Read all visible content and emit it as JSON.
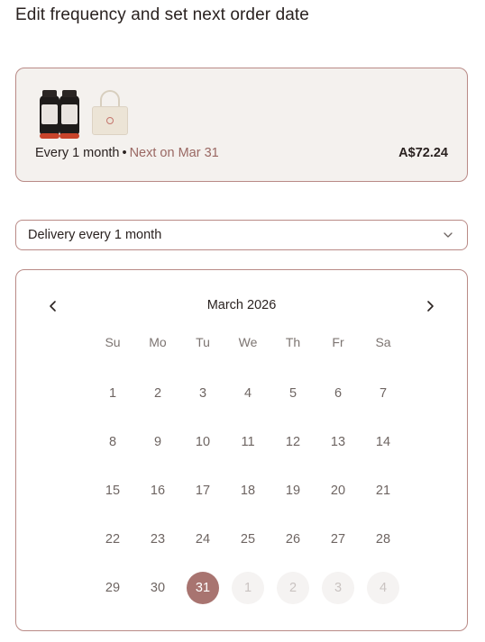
{
  "page": {
    "title": "Edit frequency and set next order date"
  },
  "summary": {
    "frequency_text": "Every 1 month",
    "separator": "•",
    "next_text": "Next on Mar 31",
    "price": "A$72.24",
    "images": [
      "supplement-bottles-image",
      "tote-bag-image"
    ]
  },
  "frequency_select": {
    "value": "Delivery every 1 month",
    "icon": "chevron-down-icon"
  },
  "calendar": {
    "month_label": "March 2026",
    "prev_icon": "chevron-left-icon",
    "next_icon": "chevron-right-icon",
    "weekdays": [
      "Su",
      "Mo",
      "Tu",
      "We",
      "Th",
      "Fr",
      "Sa"
    ],
    "days": [
      {
        "label": "1",
        "state": "normal"
      },
      {
        "label": "2",
        "state": "normal"
      },
      {
        "label": "3",
        "state": "normal"
      },
      {
        "label": "4",
        "state": "normal"
      },
      {
        "label": "5",
        "state": "normal"
      },
      {
        "label": "6",
        "state": "normal"
      },
      {
        "label": "7",
        "state": "normal"
      },
      {
        "label": "8",
        "state": "normal"
      },
      {
        "label": "9",
        "state": "normal"
      },
      {
        "label": "10",
        "state": "normal"
      },
      {
        "label": "11",
        "state": "normal"
      },
      {
        "label": "12",
        "state": "normal"
      },
      {
        "label": "13",
        "state": "normal"
      },
      {
        "label": "14",
        "state": "normal"
      },
      {
        "label": "15",
        "state": "normal"
      },
      {
        "label": "16",
        "state": "normal"
      },
      {
        "label": "17",
        "state": "normal"
      },
      {
        "label": "18",
        "state": "normal"
      },
      {
        "label": "19",
        "state": "normal"
      },
      {
        "label": "20",
        "state": "normal"
      },
      {
        "label": "21",
        "state": "normal"
      },
      {
        "label": "22",
        "state": "normal"
      },
      {
        "label": "23",
        "state": "normal"
      },
      {
        "label": "24",
        "state": "normal"
      },
      {
        "label": "25",
        "state": "normal"
      },
      {
        "label": "26",
        "state": "normal"
      },
      {
        "label": "27",
        "state": "normal"
      },
      {
        "label": "28",
        "state": "normal"
      },
      {
        "label": "29",
        "state": "normal"
      },
      {
        "label": "30",
        "state": "normal"
      },
      {
        "label": "31",
        "state": "selected"
      },
      {
        "label": "1",
        "state": "outside"
      },
      {
        "label": "2",
        "state": "outside"
      },
      {
        "label": "3",
        "state": "outside"
      },
      {
        "label": "4",
        "state": "outside"
      }
    ]
  },
  "colors": {
    "accent": "#a87470",
    "border": "#b98a86",
    "card_background": "#f4f1ee",
    "next_date_text": "#9a6863",
    "outside_day_background": "#f5f3f2"
  }
}
